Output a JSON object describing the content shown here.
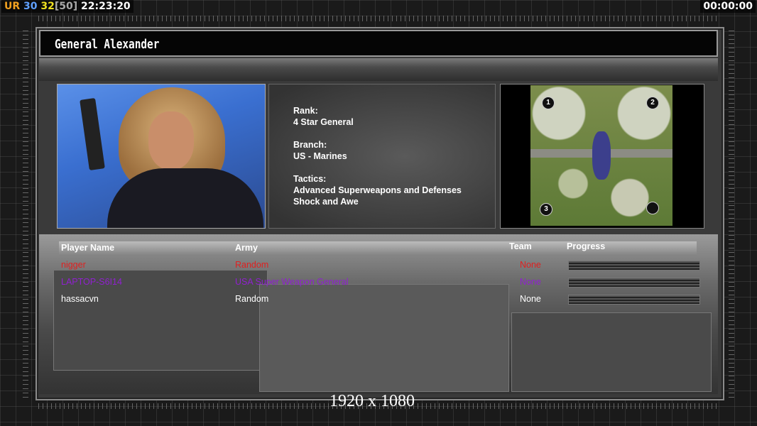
{
  "hud": {
    "left_label": "UR",
    "left_value1": "30",
    "left_value2": "32",
    "left_value3": "[50]",
    "clock": "22:23:20",
    "timer": "00:00:00"
  },
  "general": {
    "name": "General Alexander",
    "rank_label": "Rank:",
    "rank": "4 Star General",
    "branch_label": "Branch:",
    "branch": "US - Marines",
    "tactics_label": "Tactics:",
    "tactics1": "Advanced Superweapons and Defenses",
    "tactics2": "Shock and Awe"
  },
  "map": {
    "spawns": [
      "1",
      "2",
      "3",
      ""
    ]
  },
  "table": {
    "headers": {
      "player": "Player Name",
      "army": "Army",
      "team": "Team",
      "progress": "Progress"
    },
    "rows": [
      {
        "player": "nigger",
        "army": "Random",
        "team": "None",
        "color": "#e02020",
        "progress": 1.0
      },
      {
        "player": "LAPTOP-S6I14",
        "army": "USA Super Weapon General",
        "team": "None",
        "color": "#9020d0",
        "progress": 1.0
      },
      {
        "player": "hassacvn",
        "army": "Random",
        "team": "None",
        "color": "#ffffff",
        "progress": 1.0
      }
    ]
  },
  "resolution": "1920 x 1080",
  "colors": {
    "hud_ur": "#f0a020",
    "hud_30": "#60a0ff",
    "hud_32": "#f0e020",
    "hud_50": "#aaaaaa"
  }
}
